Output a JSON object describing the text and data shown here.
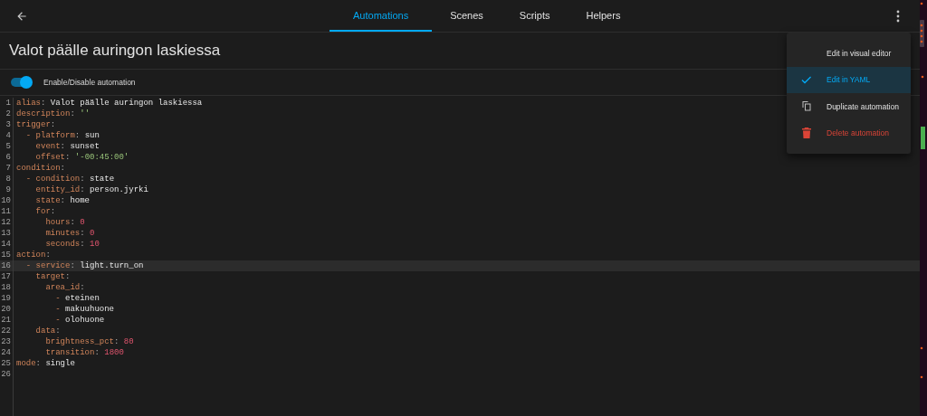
{
  "toolbar": {
    "tabs": [
      {
        "label": "Automations",
        "selected": true
      },
      {
        "label": "Scenes",
        "selected": false
      },
      {
        "label": "Scripts",
        "selected": false
      },
      {
        "label": "Helpers",
        "selected": false
      }
    ]
  },
  "title": "Valot päälle auringon laskiessa",
  "toggle": {
    "label": "Enable/Disable automation",
    "on": true
  },
  "editor": {
    "lines": [
      {
        "number": "1",
        "active": false,
        "tokens": [
          {
            "kind": "key",
            "text": "alias"
          },
          {
            "kind": "punct",
            "text": ": "
          },
          {
            "kind": "plain",
            "text": "Valot päälle auringon laskiessa"
          }
        ]
      },
      {
        "number": "2",
        "active": false,
        "tokens": [
          {
            "kind": "key",
            "text": "description"
          },
          {
            "kind": "punct",
            "text": ": "
          },
          {
            "kind": "string",
            "text": "''"
          }
        ]
      },
      {
        "number": "3",
        "active": false,
        "tokens": [
          {
            "kind": "key",
            "text": "trigger"
          },
          {
            "kind": "punct",
            "text": ":"
          }
        ]
      },
      {
        "number": "4",
        "active": false,
        "tokens": [
          {
            "kind": "dash",
            "text": "  - "
          },
          {
            "kind": "key",
            "text": "platform"
          },
          {
            "kind": "punct",
            "text": ": "
          },
          {
            "kind": "plain",
            "text": "sun"
          }
        ]
      },
      {
        "number": "5",
        "active": false,
        "tokens": [
          {
            "kind": "key",
            "text": "    event"
          },
          {
            "kind": "punct",
            "text": ": "
          },
          {
            "kind": "plain",
            "text": "sunset"
          }
        ]
      },
      {
        "number": "6",
        "active": false,
        "tokens": [
          {
            "kind": "key",
            "text": "    offset"
          },
          {
            "kind": "punct",
            "text": ": "
          },
          {
            "kind": "string",
            "text": "'-00:45:00'"
          }
        ]
      },
      {
        "number": "7",
        "active": false,
        "tokens": [
          {
            "kind": "key",
            "text": "condition"
          },
          {
            "kind": "punct",
            "text": ":"
          }
        ]
      },
      {
        "number": "8",
        "active": false,
        "tokens": [
          {
            "kind": "dash",
            "text": "  - "
          },
          {
            "kind": "key",
            "text": "condition"
          },
          {
            "kind": "punct",
            "text": ": "
          },
          {
            "kind": "plain",
            "text": "state"
          }
        ]
      },
      {
        "number": "9",
        "active": false,
        "tokens": [
          {
            "kind": "key",
            "text": "    entity_id"
          },
          {
            "kind": "punct",
            "text": ": "
          },
          {
            "kind": "plain",
            "text": "person.jyrki"
          }
        ]
      },
      {
        "number": "10",
        "active": false,
        "tokens": [
          {
            "kind": "key",
            "text": "    state"
          },
          {
            "kind": "punct",
            "text": ": "
          },
          {
            "kind": "plain",
            "text": "home"
          }
        ]
      },
      {
        "number": "11",
        "active": false,
        "tokens": [
          {
            "kind": "key",
            "text": "    for"
          },
          {
            "kind": "punct",
            "text": ":"
          }
        ]
      },
      {
        "number": "12",
        "active": false,
        "tokens": [
          {
            "kind": "key",
            "text": "      hours"
          },
          {
            "kind": "punct",
            "text": ": "
          },
          {
            "kind": "number",
            "text": "0"
          }
        ]
      },
      {
        "number": "13",
        "active": false,
        "tokens": [
          {
            "kind": "key",
            "text": "      minutes"
          },
          {
            "kind": "punct",
            "text": ": "
          },
          {
            "kind": "number",
            "text": "0"
          }
        ]
      },
      {
        "number": "14",
        "active": false,
        "tokens": [
          {
            "kind": "key",
            "text": "      seconds"
          },
          {
            "kind": "punct",
            "text": ": "
          },
          {
            "kind": "number",
            "text": "10"
          }
        ]
      },
      {
        "number": "15",
        "active": false,
        "tokens": [
          {
            "kind": "key",
            "text": "action"
          },
          {
            "kind": "punct",
            "text": ":"
          }
        ]
      },
      {
        "number": "16",
        "active": true,
        "tokens": [
          {
            "kind": "dash",
            "text": "  - "
          },
          {
            "kind": "key",
            "text": "service"
          },
          {
            "kind": "punct",
            "text": ": "
          },
          {
            "kind": "plain",
            "text": "light.turn_on"
          }
        ]
      },
      {
        "number": "17",
        "active": false,
        "tokens": [
          {
            "kind": "key",
            "text": "    target"
          },
          {
            "kind": "punct",
            "text": ":"
          }
        ]
      },
      {
        "number": "18",
        "active": false,
        "tokens": [
          {
            "kind": "key",
            "text": "      area_id"
          },
          {
            "kind": "punct",
            "text": ":"
          }
        ]
      },
      {
        "number": "19",
        "active": false,
        "tokens": [
          {
            "kind": "dash",
            "text": "        - "
          },
          {
            "kind": "plain",
            "text": "eteinen"
          }
        ]
      },
      {
        "number": "20",
        "active": false,
        "tokens": [
          {
            "kind": "dash",
            "text": "        - "
          },
          {
            "kind": "plain",
            "text": "makuuhuone"
          }
        ]
      },
      {
        "number": "21",
        "active": false,
        "tokens": [
          {
            "kind": "dash",
            "text": "        - "
          },
          {
            "kind": "plain",
            "text": "olohuone"
          }
        ]
      },
      {
        "number": "22",
        "active": false,
        "tokens": [
          {
            "kind": "key",
            "text": "    data"
          },
          {
            "kind": "punct",
            "text": ":"
          }
        ]
      },
      {
        "number": "23",
        "active": false,
        "tokens": [
          {
            "kind": "key",
            "text": "      brightness_pct"
          },
          {
            "kind": "punct",
            "text": ": "
          },
          {
            "kind": "number",
            "text": "80"
          }
        ]
      },
      {
        "number": "24",
        "active": false,
        "tokens": [
          {
            "kind": "key",
            "text": "      transition"
          },
          {
            "kind": "punct",
            "text": ": "
          },
          {
            "kind": "number",
            "text": "1800"
          }
        ]
      },
      {
        "number": "25",
        "active": false,
        "tokens": [
          {
            "kind": "key",
            "text": "mode"
          },
          {
            "kind": "punct",
            "text": ": "
          },
          {
            "kind": "plain",
            "text": "single"
          }
        ]
      },
      {
        "number": "26",
        "active": false
      }
    ]
  },
  "menu": {
    "items": [
      {
        "label": "Edit in visual editor",
        "kind": "plain",
        "selected": false
      },
      {
        "label": "Edit in YAML",
        "kind": "check",
        "selected": true
      },
      {
        "label": "Duplicate automation",
        "kind": "duplicate",
        "selected": false
      },
      {
        "label": "Delete automation",
        "kind": "delete",
        "selected": false
      }
    ]
  }
}
